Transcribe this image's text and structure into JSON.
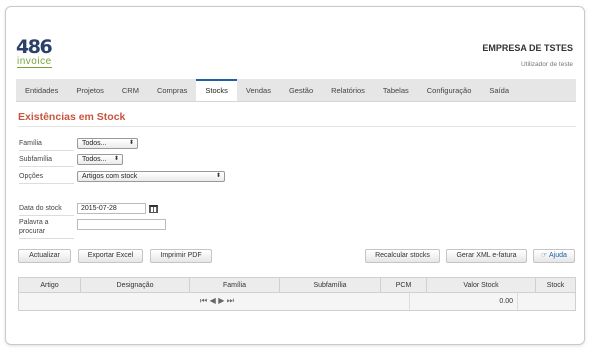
{
  "header": {
    "logo_number": "486",
    "logo_word": "invoice",
    "company": "EMPRESA DE TSTES",
    "user": "Utilizador de teste"
  },
  "nav": {
    "items": [
      "Entidades",
      "Projetos",
      "CRM",
      "Compras",
      "Stocks",
      "Vendas",
      "Gestão",
      "Relatórios",
      "Tabelas",
      "Configuração",
      "Saída"
    ],
    "active": "Stocks"
  },
  "page": {
    "title": "Existências em Stock"
  },
  "filters": {
    "familia": {
      "label": "Família",
      "value": "Todos..."
    },
    "subfamilia": {
      "label": "Subfamília",
      "value": "Todos..."
    },
    "opcoes": {
      "label": "Opções",
      "value": "Artigos com stock"
    },
    "data": {
      "label": "Data do stock",
      "value": "2015-07-28"
    },
    "palavra": {
      "label": "Palavra a procurar",
      "value": ""
    }
  },
  "buttons": {
    "actualizar": "Actualizar",
    "exportar": "Exportar Excel",
    "imprimir": "Imprimir PDF",
    "recalcular": "Recalcular stocks",
    "gerar_xml": "Gerar XML e-fatura",
    "ajuda": "Ajuda"
  },
  "table": {
    "columns": [
      "Artigo",
      "Designação",
      "Família",
      "Subfamília",
      "PCM",
      "Valor Stock",
      "Stock"
    ],
    "total": "0.00",
    "pager": [
      "⏮",
      "◀",
      "▶",
      "⏭"
    ]
  },
  "colors": {
    "accent_title": "#c8553d",
    "active_tab": "#1f5fa8",
    "logo_blue": "#2b3f6b",
    "logo_green": "#7aa43a"
  }
}
